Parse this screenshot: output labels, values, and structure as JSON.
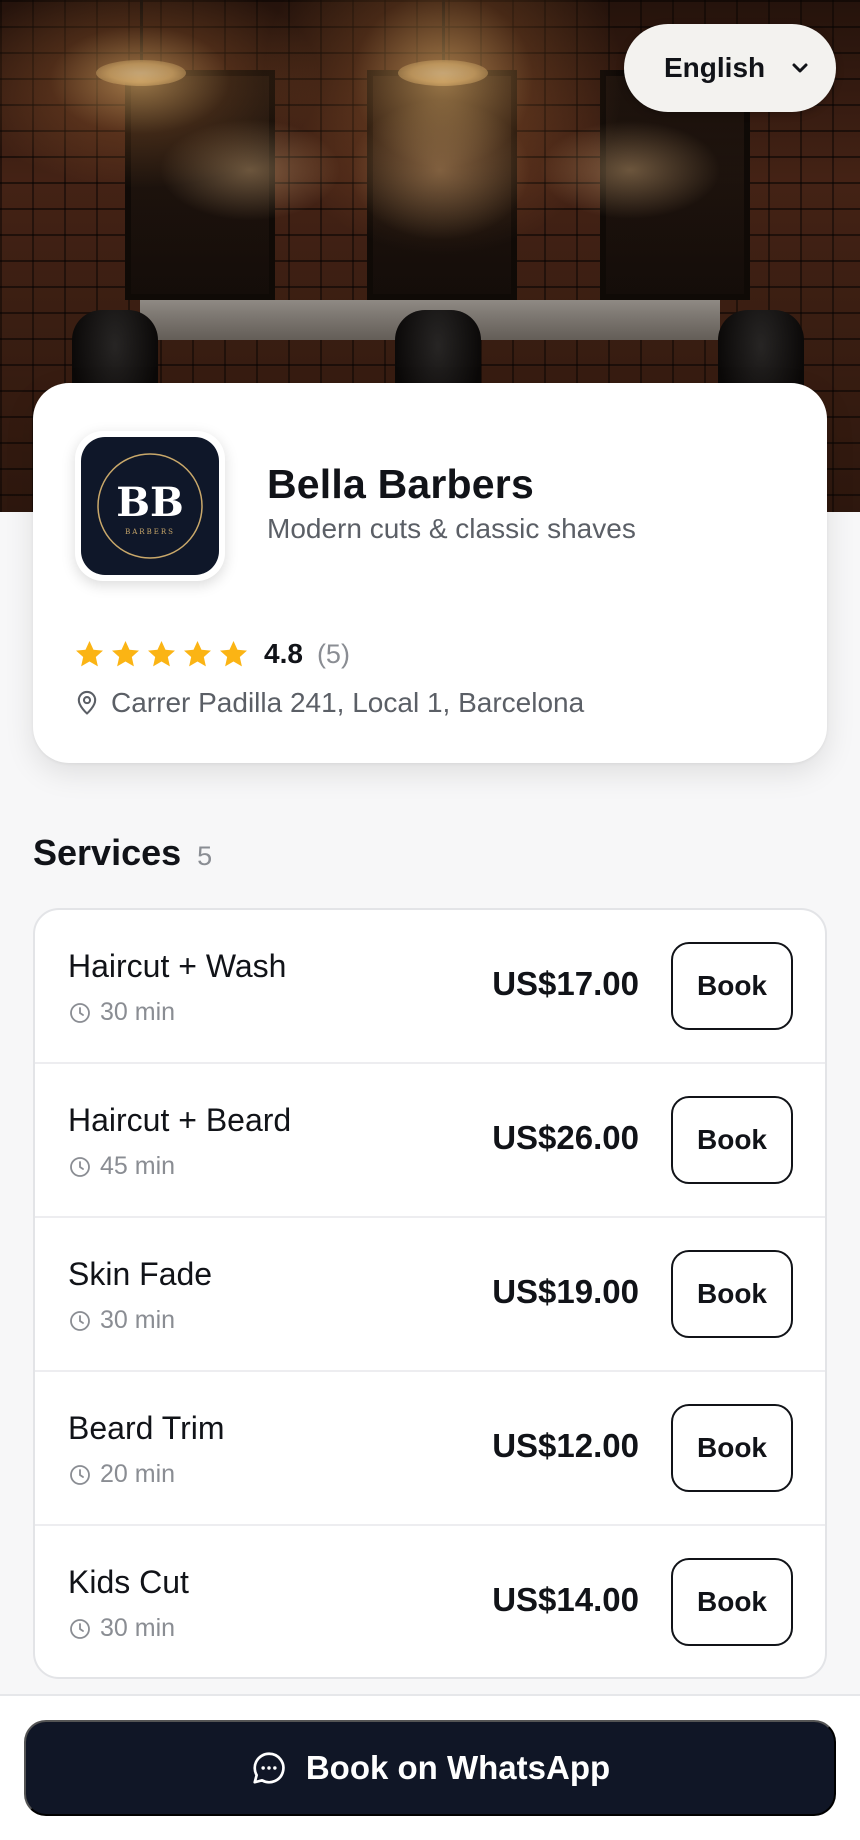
{
  "language": {
    "selected": "English"
  },
  "business": {
    "logo_monogram": "BB",
    "logo_subtext": "BARBERS",
    "name": "Bella Barbers",
    "tagline": "Modern cuts & classic shaves",
    "rating": "4.8",
    "review_count": "(5)",
    "stars_filled": 5,
    "address": "Carrer Padilla 241, Local 1, Barcelona"
  },
  "services": {
    "title": "Services",
    "count": "5",
    "book_label": "Book",
    "items": [
      {
        "name": "Haircut + Wash",
        "duration": "30 min",
        "price": "US$17.00"
      },
      {
        "name": "Haircut + Beard",
        "duration": "45 min",
        "price": "US$26.00"
      },
      {
        "name": "Skin Fade",
        "duration": "30 min",
        "price": "US$19.00"
      },
      {
        "name": "Beard Trim",
        "duration": "20 min",
        "price": "US$12.00"
      },
      {
        "name": "Kids Cut",
        "duration": "30 min",
        "price": "US$14.00"
      }
    ]
  },
  "footer": {
    "cta_label": "Book on WhatsApp"
  },
  "colors": {
    "star": "#fbb414",
    "primary_dark": "#101626",
    "logo_bg": "#0f1729",
    "logo_gold": "#c9a86a",
    "text_muted": "#8a8d93"
  },
  "icons": {
    "language_chevron": "chevron-down-icon",
    "star": "star-icon",
    "address": "map-pin-icon",
    "duration": "clock-icon",
    "cta": "whatsapp-chat-icon"
  }
}
